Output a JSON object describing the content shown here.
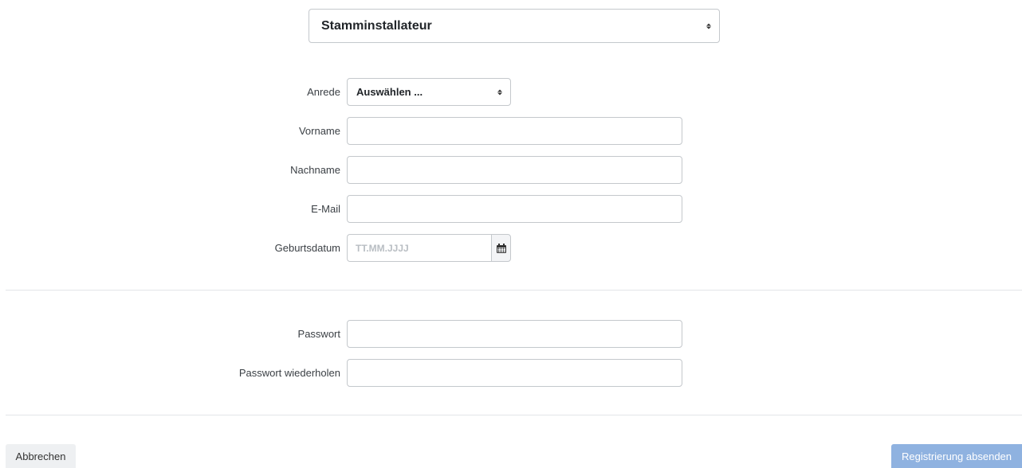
{
  "role_select": {
    "value": "Stamminstallateur"
  },
  "personal": {
    "salutation": {
      "label": "Anrede",
      "value": "Auswählen ..."
    },
    "first_name": {
      "label": "Vorname",
      "value": ""
    },
    "last_name": {
      "label": "Nachname",
      "value": ""
    },
    "email": {
      "label": "E-Mail",
      "value": ""
    },
    "birthdate": {
      "label": "Geburtsdatum",
      "placeholder": "TT.MM.JJJJ",
      "icon": "calendar-icon"
    }
  },
  "security": {
    "password": {
      "label": "Passwort",
      "value": ""
    },
    "password_repeat": {
      "label": "Passwort wiederholen",
      "value": ""
    }
  },
  "actions": {
    "cancel_label": "Abbrechen",
    "submit_label": "Registrierung absenden"
  },
  "colors": {
    "submit_bg": "#8fb2e0",
    "cancel_bg": "#eef0f2",
    "border": "#c4c8cc"
  }
}
